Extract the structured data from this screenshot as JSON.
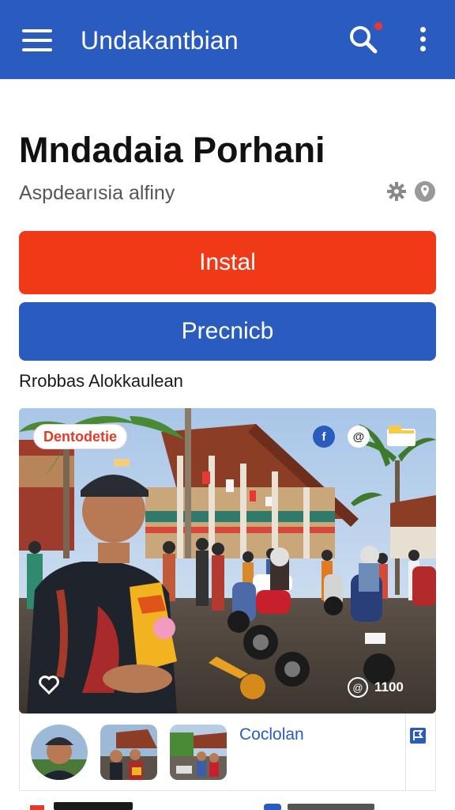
{
  "appbar": {
    "title": "Undakantbian",
    "menu_icon": "hamburger-menu-icon",
    "search_icon": "search-icon",
    "more_icon": "more-vert-icon",
    "color": "#2a5cbf"
  },
  "app": {
    "name": "Mndadaia Porhani",
    "subtitle": "Aspdearısia alfiny",
    "icons": [
      "settings-icon",
      "location-icon"
    ]
  },
  "buttons": {
    "install_label": "Instal",
    "install_color": "#f03a17",
    "preview_label": "Precnicb",
    "preview_color": "#2a5cbf"
  },
  "section": {
    "label": "Rrobbas Alokkaulean"
  },
  "hero": {
    "tag": "Dentodetie",
    "badge_blue": "f",
    "badge_white": "@",
    "folder_icon": "folder-icon",
    "heart_icon": "heart-icon",
    "view_icon": "@",
    "count": "1100"
  },
  "thumbnails": {
    "label": "Coclolan",
    "flag_icon": "flag-icon"
  }
}
